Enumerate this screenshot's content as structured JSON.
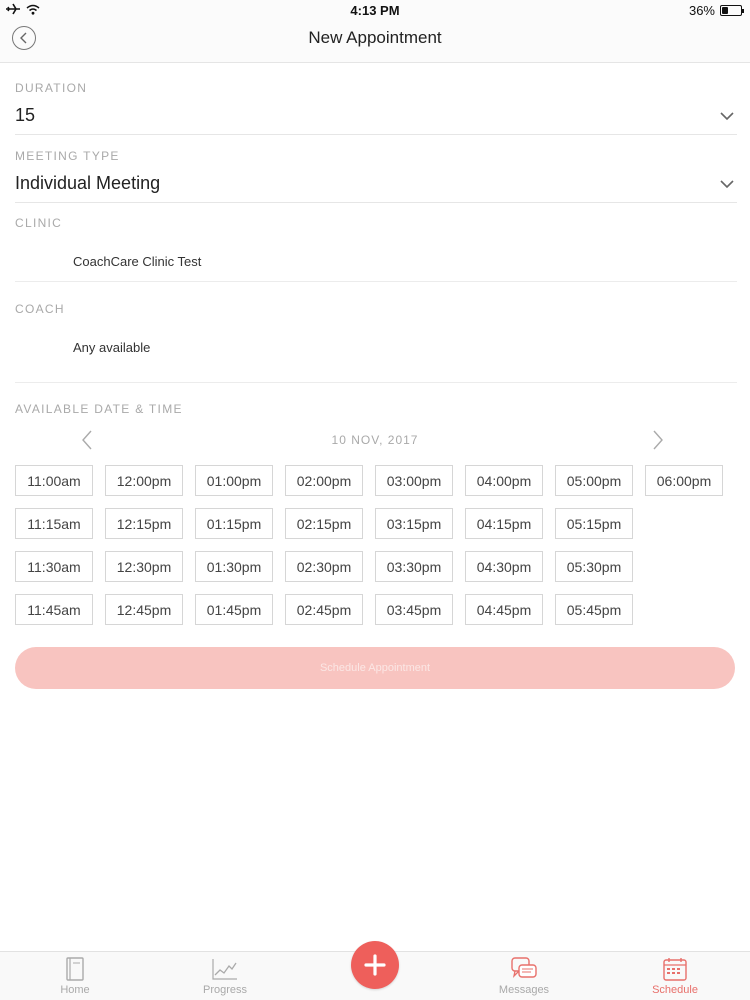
{
  "status_bar": {
    "time": "4:13 PM",
    "battery": "36%"
  },
  "nav": {
    "title": "New Appointment"
  },
  "form": {
    "duration": {
      "label": "DURATION",
      "value": "15"
    },
    "meeting_type": {
      "label": "MEETING TYPE",
      "value": "Individual Meeting"
    },
    "clinic": {
      "label": "CLINIC",
      "value": "CoachCare Clinic Test"
    },
    "coach": {
      "label": "COACH",
      "value": "Any available"
    }
  },
  "availability": {
    "label": "AVAILABLE DATE & TIME",
    "date": "10 NOV, 2017",
    "columns": [
      [
        "11:00am",
        "11:15am",
        "11:30am",
        "11:45am"
      ],
      [
        "12:00pm",
        "12:15pm",
        "12:30pm",
        "12:45pm"
      ],
      [
        "01:00pm",
        "01:15pm",
        "01:30pm",
        "01:45pm"
      ],
      [
        "02:00pm",
        "02:15pm",
        "02:30pm",
        "02:45pm"
      ],
      [
        "03:00pm",
        "03:15pm",
        "03:30pm",
        "03:45pm"
      ],
      [
        "04:00pm",
        "04:15pm",
        "04:30pm",
        "04:45pm"
      ],
      [
        "05:00pm",
        "05:15pm",
        "05:30pm",
        "05:45pm"
      ],
      [
        "06:00pm"
      ]
    ]
  },
  "schedule_button": {
    "label": "Schedule Appointment"
  },
  "tabs": [
    {
      "label": "Home",
      "icon": "book-icon"
    },
    {
      "label": "Progress",
      "icon": "chart-icon"
    },
    {
      "label": "Messages",
      "icon": "messages-icon"
    },
    {
      "label": "Schedule",
      "icon": "calendar-icon",
      "active": true
    }
  ],
  "colors": {
    "accent": "#ee5f5b",
    "button_disabled": "#f8c4c0",
    "label_gray": "#a9a9a9"
  }
}
